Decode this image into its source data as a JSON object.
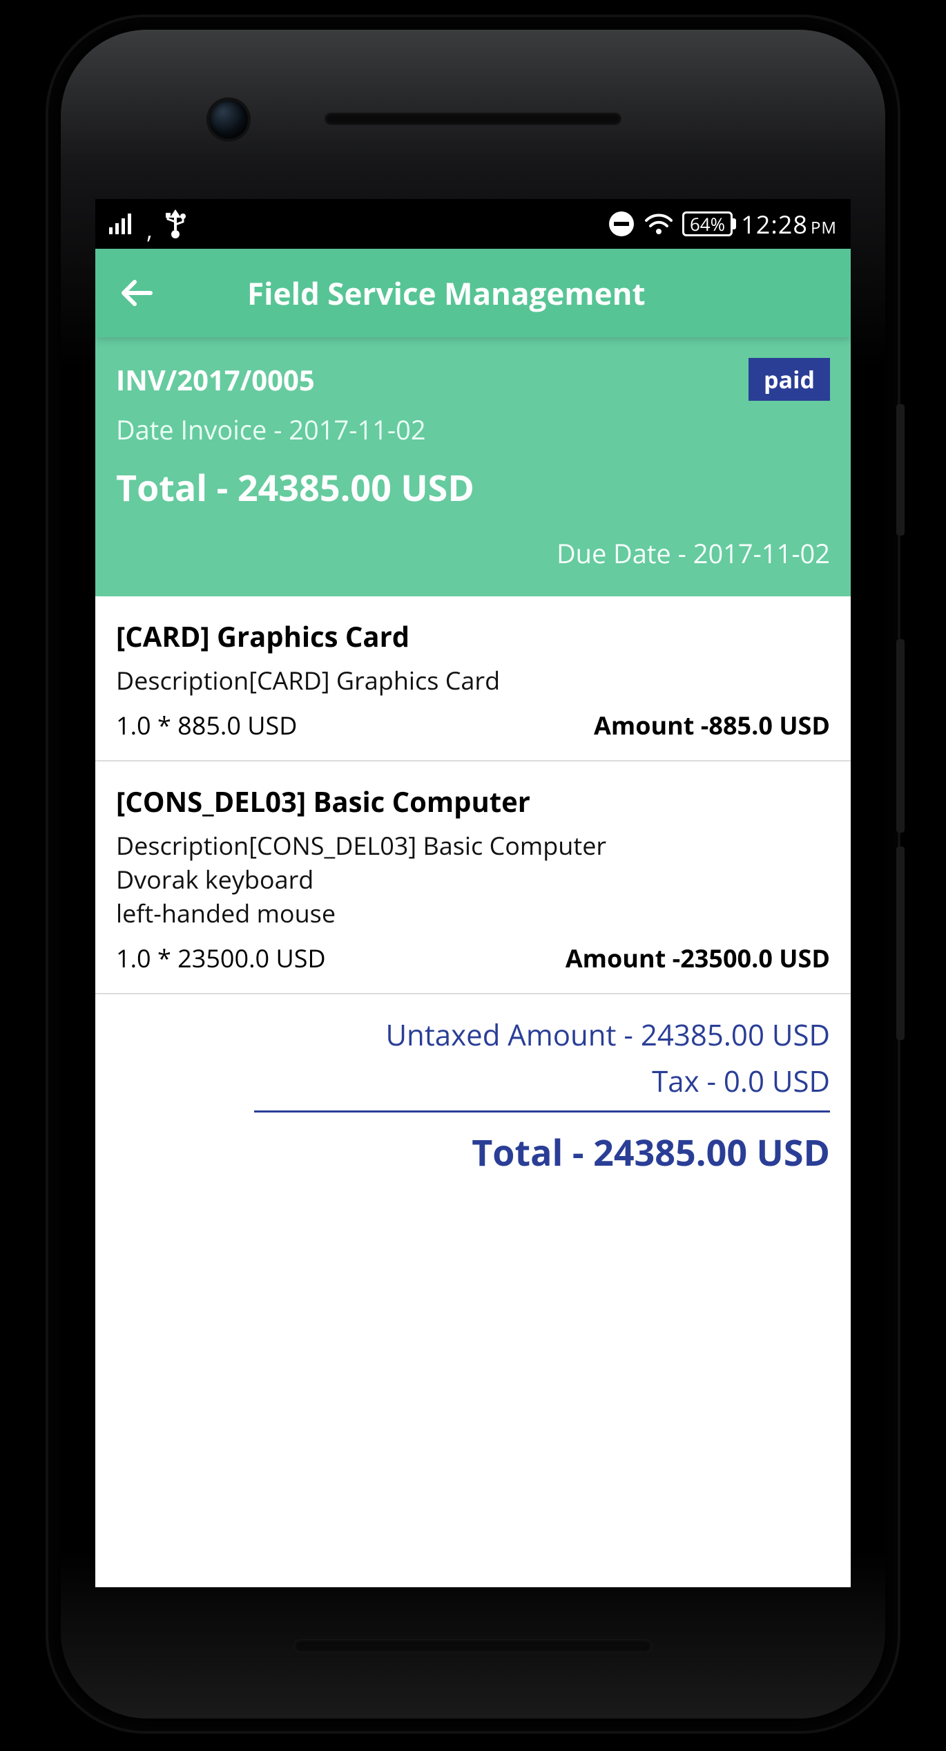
{
  "status": {
    "battery": "64%",
    "time": "12:28",
    "ampm": "PM"
  },
  "appbar": {
    "title": "Field Service Management"
  },
  "invoice": {
    "number": "INV/2017/0005",
    "badge": "paid",
    "date_label": "Date Invoice - 2017-11-02",
    "total_label": "Total - 24385.00 USD",
    "due_label": "Due Date - 2017-11-02"
  },
  "items": [
    {
      "name": "[CARD] Graphics Card",
      "description": "Description[CARD] Graphics Card",
      "qty": "1.0 * 885.0 USD",
      "amount": "Amount -885.0 USD"
    },
    {
      "name": "[CONS_DEL03] Basic Computer",
      "description": "Description[CONS_DEL03] Basic Computer\nDvorak keyboard\n          left-handed mouse",
      "qty": "1.0 * 23500.0 USD",
      "amount": "Amount -23500.0 USD"
    }
  ],
  "totals": {
    "untaxed": "Untaxed Amount - 24385.00 USD",
    "tax": "Tax - 0.0 USD",
    "grand": "Total - 24385.00 USD"
  }
}
